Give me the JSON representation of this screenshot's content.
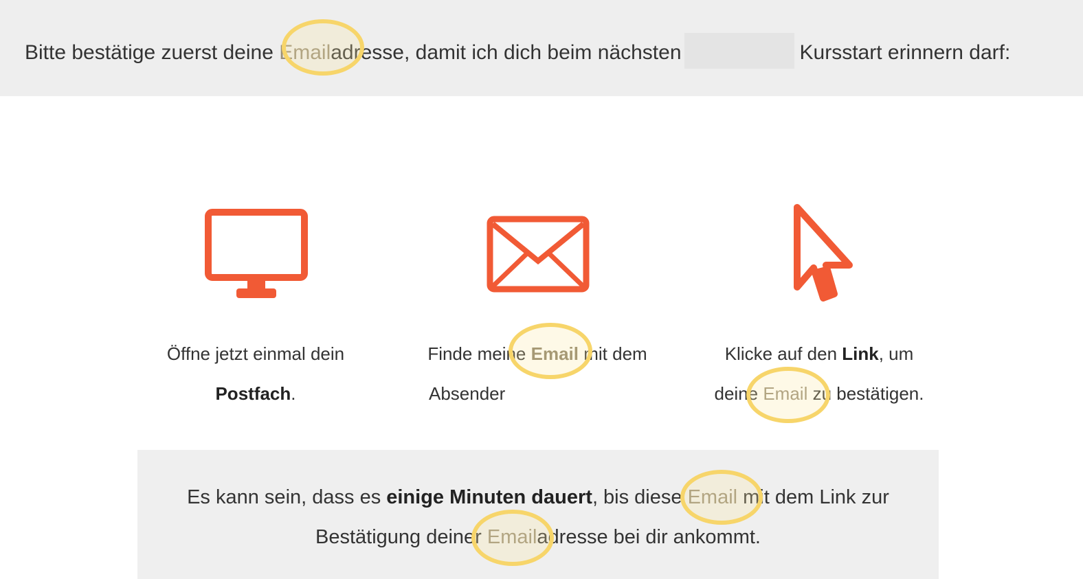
{
  "banner": {
    "text_before_highlight": "Bitte bestätige zuerst deine ",
    "highlight": "Email",
    "text_after_highlight": "adresse, damit ich dich beim nächsten",
    "text_end": "Kursstart erinnern darf:"
  },
  "steps": [
    {
      "icon": "monitor-icon",
      "line1": "Öffne jetzt einmal dein",
      "line2_bold": "Postfach",
      "line2_end": "."
    },
    {
      "icon": "envelope-icon",
      "line1_start": "Finde meine ",
      "line1_bold": "Email",
      "line1_end": " mit dem",
      "line2": "Absender"
    },
    {
      "icon": "cursor-arrow-icon",
      "line1_start": "Klicke auf den ",
      "line1_bold": "Link",
      "line1_end": ", um",
      "line2_start": "deine ",
      "line2_highlight": "Email",
      "line2_end": " zu bestätigen."
    }
  ],
  "notice": {
    "line1_start": "Es kann sein, dass es ",
    "line1_bold": "einige Minuten dauert",
    "line1_mid": ", bis diese ",
    "line1_highlight": "Email",
    "line1_end": " mit dem Link zur",
    "line2_start": "Bestätigung deiner ",
    "line2_highlight": "Email",
    "line2_end": "adresse bei dir ankommt."
  },
  "colors": {
    "accent": "#f15a35",
    "highlight_ring": "#f7d56a",
    "banner_bg": "#eeeeee",
    "notice_bg": "#efefef"
  }
}
